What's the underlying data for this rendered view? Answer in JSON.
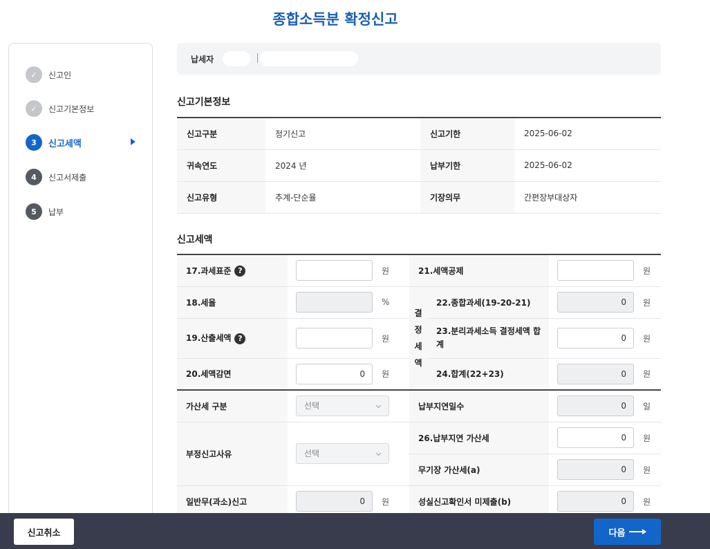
{
  "page": {
    "title": "종합소득분 확정신고"
  },
  "steps": [
    {
      "num": "✓",
      "label": "신고인",
      "state": "done"
    },
    {
      "num": "✓",
      "label": "신고기본정보",
      "state": "done"
    },
    {
      "num": "3",
      "label": "신고세액",
      "state": "active"
    },
    {
      "num": "4",
      "label": "신고서제출",
      "state": "todo"
    },
    {
      "num": "5",
      "label": "납부",
      "state": "todo"
    }
  ],
  "taxpayer": {
    "label": "납세자"
  },
  "basic_info": {
    "title": "신고기본정보",
    "rows": [
      {
        "k1": "신고구분",
        "v1": "정기신고",
        "k2": "신고기한",
        "v2": "2025-06-02"
      },
      {
        "k1": "귀속연도",
        "v1": "2024 년",
        "k2": "납부기한",
        "v2": "2025-06-02"
      },
      {
        "k1": "신고유형",
        "v1": "추계-단순율",
        "k2": "기장의무",
        "v2": "간편장부대상자"
      }
    ]
  },
  "tax": {
    "title": "신고세액",
    "group_label": "결\n정\n세\n액",
    "f17": {
      "label": "17.과세표준",
      "value": "",
      "unit": "원"
    },
    "f18": {
      "label": "18.세율",
      "value": "",
      "unit": "%"
    },
    "f19": {
      "label": "19.산출세액",
      "value": "",
      "unit": "원"
    },
    "f20": {
      "label": "20.세액감면",
      "value": "0",
      "unit": "원"
    },
    "f21": {
      "label": "21.세액공제",
      "value": "",
      "unit": "원"
    },
    "f22": {
      "label": "22.종합과세(19-20-21)",
      "value": "0",
      "unit": "원"
    },
    "f23": {
      "label": "23.분리과세소득 결정세액 합계",
      "value": "0",
      "unit": "원"
    },
    "f24": {
      "label": "24.합계(22+23)",
      "value": "0",
      "unit": "원"
    },
    "penalty_type": {
      "label": "가산세 구분",
      "value": "선택"
    },
    "delay_days": {
      "label": "납부지연일수",
      "value": "0",
      "unit": "일"
    },
    "improper_reason": {
      "label": "부정신고사유",
      "value": "선택"
    },
    "f26": {
      "label": "26.납부지연 가산세",
      "value": "0",
      "unit": "원"
    },
    "no_book": {
      "label": "무기장 가산세(a)",
      "value": "0",
      "unit": "원"
    },
    "general_under": {
      "label": "일반무(과소)신고",
      "value": "0",
      "unit": "원"
    },
    "sincere": {
      "label": "성실신고확인서 미제출(b)",
      "value": "0",
      "unit": "원"
    }
  },
  "footer": {
    "cancel_label": "신고취소",
    "next_label": "다음"
  },
  "help_icon": "?",
  "colors": {
    "primary": "#1366c9",
    "footer": "#383c4c"
  }
}
